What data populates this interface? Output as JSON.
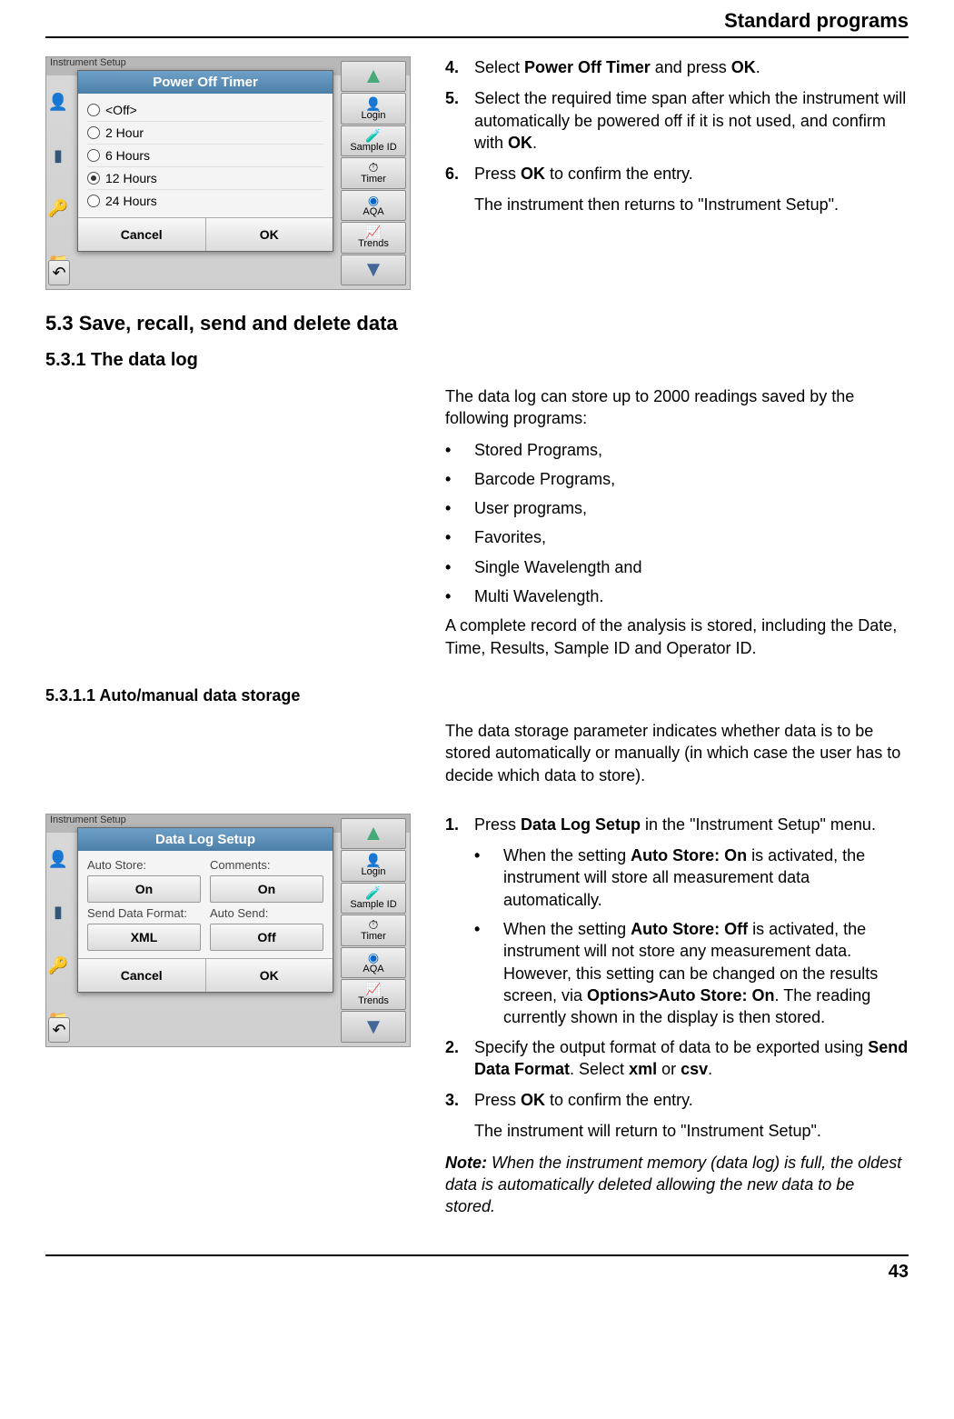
{
  "header": {
    "title": "Standard programs"
  },
  "footer": {
    "page": "43"
  },
  "section1": {
    "steps": {
      "s4": {
        "num": "4.",
        "a": "Select ",
        "b": "Power Off Timer",
        "c": " and press ",
        "d": "OK",
        "e": "."
      },
      "s5": {
        "num": "5.",
        "a": "Select the required time span after which the instrument will automatically be powered off if it is not used, and confirm with ",
        "b": "OK",
        "c": "."
      },
      "s6": {
        "num": "6.",
        "a": "Press ",
        "b": "OK",
        "c": " to confirm the entry."
      },
      "follow": "The instrument then returns to \"Instrument Setup\"."
    },
    "screenshot": {
      "topbar": "Instrument Setup",
      "dialog_title": "Power Off Timer",
      "options": [
        {
          "label": "<Off>",
          "selected": false
        },
        {
          "label": "2 Hour",
          "selected": false
        },
        {
          "label": "6 Hours",
          "selected": false
        },
        {
          "label": "12 Hours",
          "selected": true
        },
        {
          "label": "24 Hours",
          "selected": false
        }
      ],
      "cancel": "Cancel",
      "ok": "OK"
    }
  },
  "sidebar_labels": {
    "login": "Login",
    "sample_id": "Sample ID",
    "timer": "Timer",
    "aqa": "AQA",
    "trends": "Trends"
  },
  "headings": {
    "h53": "5.3    Save, recall, send and delete data",
    "h531": "5.3.1     The data log",
    "h5311": "5.3.1.1     Auto/manual data storage"
  },
  "datalog": {
    "intro": "The data log can store up to 2000 readings saved by the following programs:",
    "bullets": {
      "b1": "Stored Programs,",
      "b2": "Barcode Programs,",
      "b3": "User programs,",
      "b4": "Favorites,",
      "b5": "Single Wavelength and",
      "b6": "Multi Wavelength."
    },
    "outro": "A complete record of the analysis is stored, including the Date, Time, Results, Sample ID and Operator ID."
  },
  "autostorage": {
    "intro": "The data storage parameter indicates whether data is to be stored automatically or manually (in which case the user has to decide which data to store).",
    "s1": {
      "num": "1.",
      "a": "Press ",
      "b": "Data Log Setup",
      "c": " in the \"Instrument Setup\" menu."
    },
    "sb1": {
      "a": "When the setting ",
      "b": "Auto Store: On",
      "c": " is activated, the instrument will store all measurement data automatically."
    },
    "sb2": {
      "a": "When the setting ",
      "b": "Auto Store: Off",
      "c": " is activated, the instrument will not store any measurement data. However, this setting can be changed on the results screen, via ",
      "d": "Options>Auto Store: On",
      "e": ". The reading currently shown in the display is then stored."
    },
    "s2": {
      "num": "2.",
      "a": "Specify the output format of data to be exported using ",
      "b": "Send Data Format",
      "c": ". Select ",
      "d": "xml",
      "e": " or ",
      "f": "csv",
      "g": "."
    },
    "s3": {
      "num": "3.",
      "a": "Press ",
      "b": "OK",
      "c": " to confirm the entry."
    },
    "follow": "The instrument will return to \"Instrument Setup\".",
    "note": {
      "a": "Note:",
      "b": " When the instrument memory (data log) is full, the oldest data is automatically deleted allowing the new data to be stored."
    },
    "screenshot": {
      "dialog_title": "Data Log Setup",
      "labels": {
        "autostore": "Auto Store:",
        "comments": "Comments:",
        "sendformat": "Send Data Format:",
        "autosend": "Auto Send:"
      },
      "values": {
        "autostore": "On",
        "comments": "On",
        "sendformat": "XML",
        "autosend": "Off"
      },
      "cancel": "Cancel",
      "ok": "OK"
    }
  }
}
